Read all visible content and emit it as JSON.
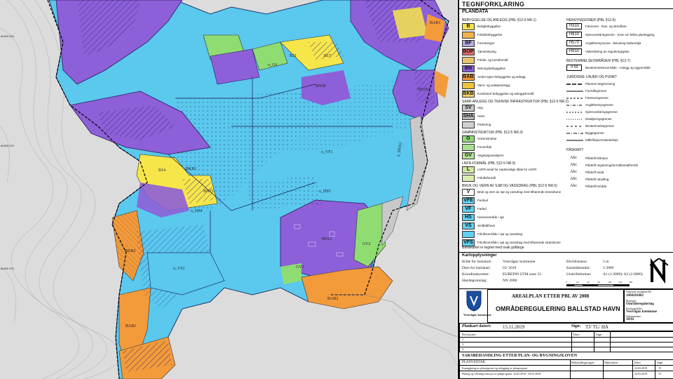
{
  "map": {
    "labels": [
      {
        "text": "o_G6",
        "pos": "a"
      },
      {
        "text": "B21",
        "pos": "b"
      },
      {
        "text": "B17",
        "pos": "c"
      },
      {
        "text": "BN18",
        "pos": "d"
      },
      {
        "text": "BN19",
        "pos": "e"
      },
      {
        "text": "o_VF1",
        "pos": "f"
      },
      {
        "text": "B14",
        "pos": "g"
      },
      {
        "text": "BKB1",
        "pos": "h"
      },
      {
        "text": "o_HS5",
        "pos": "i"
      },
      {
        "text": "BN12",
        "pos": "j"
      },
      {
        "text": "GV2",
        "pos": "k"
      },
      {
        "text": "GV1",
        "pos": "l"
      },
      {
        "text": "BAB2",
        "pos": "m"
      },
      {
        "text": "o_VS1",
        "pos": "n"
      },
      {
        "text": "BKB2",
        "pos": "o"
      },
      {
        "text": "BAB1",
        "pos": "p"
      },
      {
        "text": "o_HS4",
        "pos": "q"
      },
      {
        "text": "o_SHA1",
        "pos": "r"
      },
      {
        "text": "BAR1",
        "pos": "s"
      },
      {
        "text": "BN15",
        "pos": "t"
      }
    ],
    "coords": [
      "6 765 000",
      "6 765 000",
      "6 765 000"
    ]
  },
  "legend": {
    "title": "TEGNFORKLARING",
    "plandata": "PLANDATA",
    "sec_bebyggelse": "BEBYGGELSE OG ANLEGG (PBL §12-5 NR.1)",
    "sec_hensyn": "HENSYNSSONER (PBL §12-6)",
    "items_left": [
      {
        "code": "B",
        "label": "Boligbebyggelse",
        "color": "#f5e14c"
      },
      {
        "code": "",
        "label": "Fritidsbebyggelse",
        "color": "#f2b24a"
      },
      {
        "code": "BF",
        "label": "Forretninger",
        "color": "#b6a9e0"
      },
      {
        "code": "BOP",
        "label": "Tjenesteyting",
        "color": "#e06a6a"
      },
      {
        "code": "",
        "label": "Fritids- og turistformål",
        "color": "#e9c36b"
      },
      {
        "code": "BN",
        "label": "Næringsbebyggelse",
        "color": "#8a5ed6"
      },
      {
        "code": "BAB",
        "label": "Andre typer bebyggelse og anlegg",
        "color": "#f09a3c"
      },
      {
        "code": "",
        "label": "Vann- og avløpsanlegg",
        "color": "#f0c23c"
      },
      {
        "code": "BKB",
        "label": "Kombinert bebyggelse og anleggsformål",
        "color": "#f5d26a"
      }
    ],
    "sec_samf": "SAMF.ANLEGG OG TEKNISK INFRASTRUKTUR (PBL §12-5 NR.2)",
    "items_samf": [
      {
        "code": "SV",
        "label": "Veg",
        "color": "#c8c8c8"
      },
      {
        "code": "SHA",
        "label": "Havn",
        "color": "#b9b9b9"
      },
      {
        "code": "",
        "label": "Parkering",
        "color": "#d0d0d0"
      }
    ],
    "sec_gronn": "GRØNNSTRUKTUR (PBL §12-5 NR.3)",
    "items_gronn": [
      {
        "code": "G",
        "label": "Grønnstruktur",
        "color": "#8fd77a"
      },
      {
        "code": "",
        "label": "Friområde",
        "color": "#a6e08e"
      },
      {
        "code": "GV",
        "label": "Vegetasjonsskjerm",
        "color": "#b4e69a"
      }
    ],
    "sec_lnfr": "LNFR-FORMÅL (PBL §12-5 NR.5)",
    "items_lnfr": [
      {
        "code": "L",
        "label": "LNFR-areal for nødvendige tiltak for LNFR",
        "color": "#cfe8a0"
      },
      {
        "code": "",
        "label": "Friluftsformål",
        "color": "#d8ecb0"
      }
    ],
    "sec_bruk": "BRUK OG VERN AV SJØ OG VASSDRAG (PBL §12-5 NR.6)",
    "items_bruk": [
      {
        "code": "V",
        "label": "Bruk og vern av sjø og vassdrag med tilhørende strandsone",
        "color": "#ffffff"
      },
      {
        "code": "VFE",
        "label": "Ferdsel",
        "color": "#5fd0f0"
      },
      {
        "code": "VF",
        "label": "Farled",
        "color": "#5fd0f0"
      },
      {
        "code": "HS",
        "label": "Havneområde i sjø",
        "color": "#5fd0f0"
      },
      {
        "code": "VS",
        "label": "Småbåthavn",
        "color": "#5fd0f0"
      },
      {
        "code": "",
        "label": "Friluftsområde i sjø og vassdrag",
        "color": "#5fd0f0"
      },
      {
        "code": "VFS",
        "label": "Friluftsområde i sjø og vassdrag med tilhørende strandsone",
        "color": "#5fd0f0"
      }
    ],
    "hensyn": [
      {
        "code": "H310",
        "label": "Faresone - Ras- og skredfare"
      },
      {
        "code": "H810",
        "label": "Gjennomføringssone - Krav om felles planlegging"
      },
      {
        "code": "H570",
        "label": "Angitthensynsone - Bevaring kulturmiljø"
      },
      {
        "code": "H910",
        "label": "Videreføring av reguleringsplan"
      }
    ],
    "sec_best": "BESTEMMELSEOMRÅDER (PBL §12-7)",
    "best_item": {
      "code": "# M",
      "label": "Bestemmelsesområde - Anlegg og riggområde"
    },
    "sec_jur": "JURIDISKE LINJER OG PUNKT",
    "lines": [
      "Planens begrensning",
      "Formålsgrense",
      "Faresonegrense",
      "Angitthensyngrense",
      "Gjennomføringsgrense",
      "Detaljeringsgrense",
      "Bestemmelsegrense",
      "Byggegrense",
      "Måle/linje/Avstandslinje"
    ],
    "sec_paskrift": "PÅSKRIFT",
    "paskrift": [
      {
        "sym": "Abc",
        "label": "Påskrift feltnavn"
      },
      {
        "sym": "Abc",
        "label": "Påskrift reguleringsformål/arealformål"
      },
      {
        "sym": "Abc",
        "label": "Påskrift areal"
      },
      {
        "sym": "Abc",
        "label": "Påskrift utnytting"
      },
      {
        "sym": "Abc",
        "label": "Påskrift bredde"
      }
    ],
    "basis_note": "Basiskartet er tegnet med svak gråfarge"
  },
  "kartopp": {
    "title": "Kartopplysninger",
    "rows": [
      {
        "k": "Kilde for basiskart:",
        "v": "Vestvågøy kommune",
        "k2": "Ekvidistanse:",
        "v2": "5    m"
      },
      {
        "k": "Dato for basiskart:",
        "v": "01/ 2018",
        "k2": "Kartmålestokk:",
        "v2": "1:3000"
      },
      {
        "k": "Koordinatsystem:",
        "v": "EUREF89 UTM sone 33",
        "k2": "Utskriftsformat:",
        "v2": "A1 (1:3000)/ A3 (1:6000)"
      },
      {
        "k": "Høydegrunnlag:",
        "v": "NN 2000",
        "k2": "",
        "v2": ""
      }
    ],
    "scale_ticks": [
      "0",
      "10",
      "20",
      "50",
      "100",
      "150",
      "200"
    ]
  },
  "titleblock": {
    "heading": "AREALPLAN ETTER PBL AV 2008",
    "plan_name": "OMRÅDEREGULERING BALLSTAD HAVN",
    "municipality": "Vestvågøy kommune",
    "plankart_label": "Plankart datert:",
    "plankart_date": "15.11.2019",
    "sign_label": "Sign:",
    "sign_value": "TJ/ TL/ HA",
    "nasjonal_label": "Nasjonal arealplan-ID:",
    "nasjonal_id": "1860201802",
    "plantype_label": "Plantype:",
    "plantype": "Områderegulering",
    "forslag_label": "Forslagsstiller:",
    "forslag": "Vestvågøy kommune",
    "saksnr_label": "Saksnummer:",
    "saksnr": "18/82",
    "rev_header": [
      "Revisjoner:",
      "",
      "Dato",
      "Sign"
    ],
    "rev_rows": [
      "1",
      "2",
      "3"
    ],
    "saksbeh": "SAKSBEHANDLING ETTER PLAN- OG BYGNINGSLOVEN",
    "saks_header": [
      "PLANVEDTAK",
      "Behandlingsorgan",
      "Møtesaknr",
      "Dato",
      "Sign"
    ],
    "saks_rows": [
      {
        "a": "Kunngjøring av planoppstart og utlegging av planprogram",
        "d": "24.03.2018",
        "e": "TJ"
      },
      {
        "a": "Høring og offentlig ettersyn av planprogram: 24.03.2018 - 04.05.2018",
        "d": "24.03.2018",
        "e": "TJ"
      }
    ]
  },
  "colors": {
    "sea": "#5bc8ee",
    "bolig": "#f7e64a",
    "naering": "#8d5fd8",
    "orange": "#f39a3a",
    "green": "#8fdc73",
    "grey": "#c9c9c9",
    "land": "#dedede"
  }
}
